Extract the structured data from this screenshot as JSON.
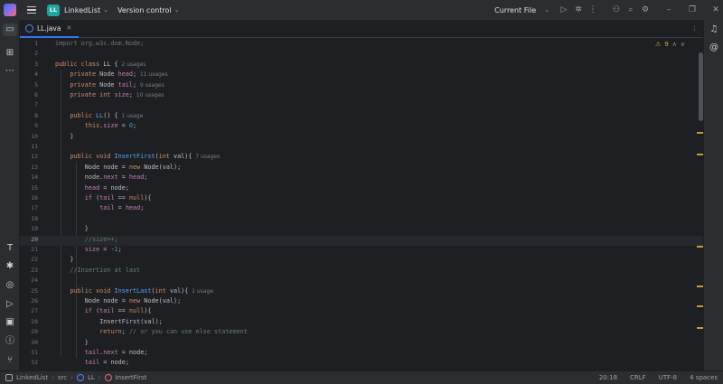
{
  "titlebar": {
    "project_badge": "LL",
    "project_name": "LinkedList",
    "vcs_label": "Version control",
    "run_config": "Current File"
  },
  "tab": {
    "filename": "LL.java"
  },
  "editor": {
    "warnings_count": "9",
    "current_line": 20,
    "lines": [
      {
        "n": "1",
        "indent": 0,
        "tokens": [
          {
            "t": "import org.w3c.dom.Node;",
            "c": "imp"
          }
        ]
      },
      {
        "n": "2",
        "indent": 0,
        "tokens": []
      },
      {
        "n": "3",
        "indent": 0,
        "tokens": [
          {
            "t": "public class ",
            "c": "kw"
          },
          {
            "t": "LL {",
            "c": "cls"
          },
          {
            "t": "  2 usages",
            "c": "hint"
          }
        ]
      },
      {
        "n": "4",
        "indent": 1,
        "tokens": [
          {
            "t": "private ",
            "c": "kw"
          },
          {
            "t": "Node ",
            "c": "cls"
          },
          {
            "t": "head",
            "c": "fld"
          },
          {
            "t": ";",
            "c": "cls"
          },
          {
            "t": "  11 usages",
            "c": "hint"
          }
        ]
      },
      {
        "n": "5",
        "indent": 1,
        "tokens": [
          {
            "t": "private ",
            "c": "kw"
          },
          {
            "t": "Node ",
            "c": "cls"
          },
          {
            "t": "tail",
            "c": "fld"
          },
          {
            "t": ";",
            "c": "cls"
          },
          {
            "t": "  9 usages",
            "c": "hint"
          }
        ]
      },
      {
        "n": "6",
        "indent": 1,
        "tokens": [
          {
            "t": "private int ",
            "c": "kw"
          },
          {
            "t": "size",
            "c": "fld"
          },
          {
            "t": ";",
            "c": "cls"
          },
          {
            "t": "  10 usages",
            "c": "hint"
          }
        ]
      },
      {
        "n": "7",
        "indent": 0,
        "tokens": []
      },
      {
        "n": "8",
        "indent": 1,
        "tokens": [
          {
            "t": "public ",
            "c": "kw"
          },
          {
            "t": "LL",
            "c": "fn"
          },
          {
            "t": "() {",
            "c": "cls"
          },
          {
            "t": "  1 usage",
            "c": "hint"
          }
        ]
      },
      {
        "n": "9",
        "indent": 2,
        "tokens": [
          {
            "t": "this",
            "c": "kw"
          },
          {
            "t": ".",
            "c": "cls"
          },
          {
            "t": "size",
            "c": "fld"
          },
          {
            "t": " = ",
            "c": "cls"
          },
          {
            "t": "0",
            "c": "num"
          },
          {
            "t": ";",
            "c": "cls"
          }
        ]
      },
      {
        "n": "10",
        "indent": 1,
        "tokens": [
          {
            "t": "}",
            "c": "cls"
          }
        ]
      },
      {
        "n": "11",
        "indent": 0,
        "tokens": []
      },
      {
        "n": "12",
        "indent": 1,
        "tokens": [
          {
            "t": "public void ",
            "c": "kw"
          },
          {
            "t": "InsertFirst",
            "c": "fn"
          },
          {
            "t": "(",
            "c": "cls"
          },
          {
            "t": "int ",
            "c": "kw"
          },
          {
            "t": "val){",
            "c": "cls"
          },
          {
            "t": "  7 usages",
            "c": "hint"
          }
        ]
      },
      {
        "n": "13",
        "indent": 2,
        "tokens": [
          {
            "t": "Node node = ",
            "c": "cls"
          },
          {
            "t": "new ",
            "c": "kw"
          },
          {
            "t": "Node(val);",
            "c": "cls"
          }
        ]
      },
      {
        "n": "14",
        "indent": 2,
        "tokens": [
          {
            "t": "node.",
            "c": "cls"
          },
          {
            "t": "next",
            "c": "fld"
          },
          {
            "t": " = ",
            "c": "cls"
          },
          {
            "t": "head",
            "c": "fld"
          },
          {
            "t": ";",
            "c": "cls"
          }
        ]
      },
      {
        "n": "15",
        "indent": 2,
        "tokens": [
          {
            "t": "head",
            "c": "fld"
          },
          {
            "t": " = node;",
            "c": "cls"
          }
        ]
      },
      {
        "n": "16",
        "indent": 2,
        "tokens": [
          {
            "t": "if ",
            "c": "kw"
          },
          {
            "t": "(",
            "c": "cls"
          },
          {
            "t": "tail",
            "c": "fld"
          },
          {
            "t": " == ",
            "c": "cls"
          },
          {
            "t": "null",
            "c": "kw"
          },
          {
            "t": "){",
            "c": "cls"
          }
        ]
      },
      {
        "n": "17",
        "indent": 3,
        "tokens": [
          {
            "t": "tail",
            "c": "fld"
          },
          {
            "t": " = ",
            "c": "cls"
          },
          {
            "t": "head",
            "c": "fld"
          },
          {
            "t": ";",
            "c": "cls"
          }
        ]
      },
      {
        "n": "18",
        "indent": 0,
        "tokens": []
      },
      {
        "n": "19",
        "indent": 2,
        "tokens": [
          {
            "t": "}",
            "c": "cls"
          }
        ]
      },
      {
        "n": "20",
        "indent": 2,
        "tokens": [
          {
            "t": "//size++;",
            "c": "cmtg"
          }
        ]
      },
      {
        "n": "21",
        "indent": 2,
        "tokens": [
          {
            "t": "size",
            "c": "fld"
          },
          {
            "t": " = -",
            "c": "cls"
          },
          {
            "t": "1",
            "c": "num"
          },
          {
            "t": ";",
            "c": "cls"
          }
        ]
      },
      {
        "n": "22",
        "indent": 1,
        "tokens": [
          {
            "t": "}",
            "c": "cls"
          }
        ]
      },
      {
        "n": "23",
        "indent": 1,
        "tokens": [
          {
            "t": "//Insertion at last",
            "c": "cmtg"
          }
        ]
      },
      {
        "n": "24",
        "indent": 0,
        "tokens": []
      },
      {
        "n": "25",
        "indent": 1,
        "tokens": [
          {
            "t": "public void ",
            "c": "kw"
          },
          {
            "t": "InsertLast",
            "c": "fn"
          },
          {
            "t": "(",
            "c": "cls"
          },
          {
            "t": "int ",
            "c": "kw"
          },
          {
            "t": "val){",
            "c": "cls"
          },
          {
            "t": "  1 usage",
            "c": "hint"
          }
        ]
      },
      {
        "n": "26",
        "indent": 2,
        "tokens": [
          {
            "t": "Node node = ",
            "c": "cls"
          },
          {
            "t": "new ",
            "c": "kw"
          },
          {
            "t": "Node(val);",
            "c": "cls"
          }
        ]
      },
      {
        "n": "27",
        "indent": 2,
        "tokens": [
          {
            "t": "if ",
            "c": "kw"
          },
          {
            "t": "(",
            "c": "cls"
          },
          {
            "t": "tail",
            "c": "fld"
          },
          {
            "t": " == ",
            "c": "cls"
          },
          {
            "t": "null",
            "c": "kw"
          },
          {
            "t": "){",
            "c": "cls"
          }
        ]
      },
      {
        "n": "28",
        "indent": 3,
        "tokens": [
          {
            "t": "InsertFirst",
            "c": "cls"
          },
          {
            "t": "(val);",
            "c": "cls"
          }
        ]
      },
      {
        "n": "29",
        "indent": 3,
        "tokens": [
          {
            "t": "return",
            "c": "kw"
          },
          {
            "t": "; ",
            "c": "cls"
          },
          {
            "t": "// or you can use else statement",
            "c": "cmtg"
          }
        ]
      },
      {
        "n": "30",
        "indent": 2,
        "tokens": [
          {
            "t": "}",
            "c": "cls"
          }
        ]
      },
      {
        "n": "31",
        "indent": 2,
        "tokens": [
          {
            "t": "tail",
            "c": "fld"
          },
          {
            "t": ".",
            "c": "cls"
          },
          {
            "t": "next",
            "c": "fld"
          },
          {
            "t": " = node;",
            "c": "cls"
          }
        ]
      },
      {
        "n": "32",
        "indent": 2,
        "tokens": [
          {
            "t": "tail",
            "c": "fld"
          },
          {
            "t": " = node;",
            "c": "cls"
          }
        ]
      }
    ]
  },
  "statusbar": {
    "breadcrumbs": [
      "LinkedList",
      "src",
      "LL",
      "InsertFirst"
    ],
    "position": "20:18",
    "line_sep": "CRLF",
    "encoding": "UTF-8",
    "indent": "4 spaces"
  }
}
